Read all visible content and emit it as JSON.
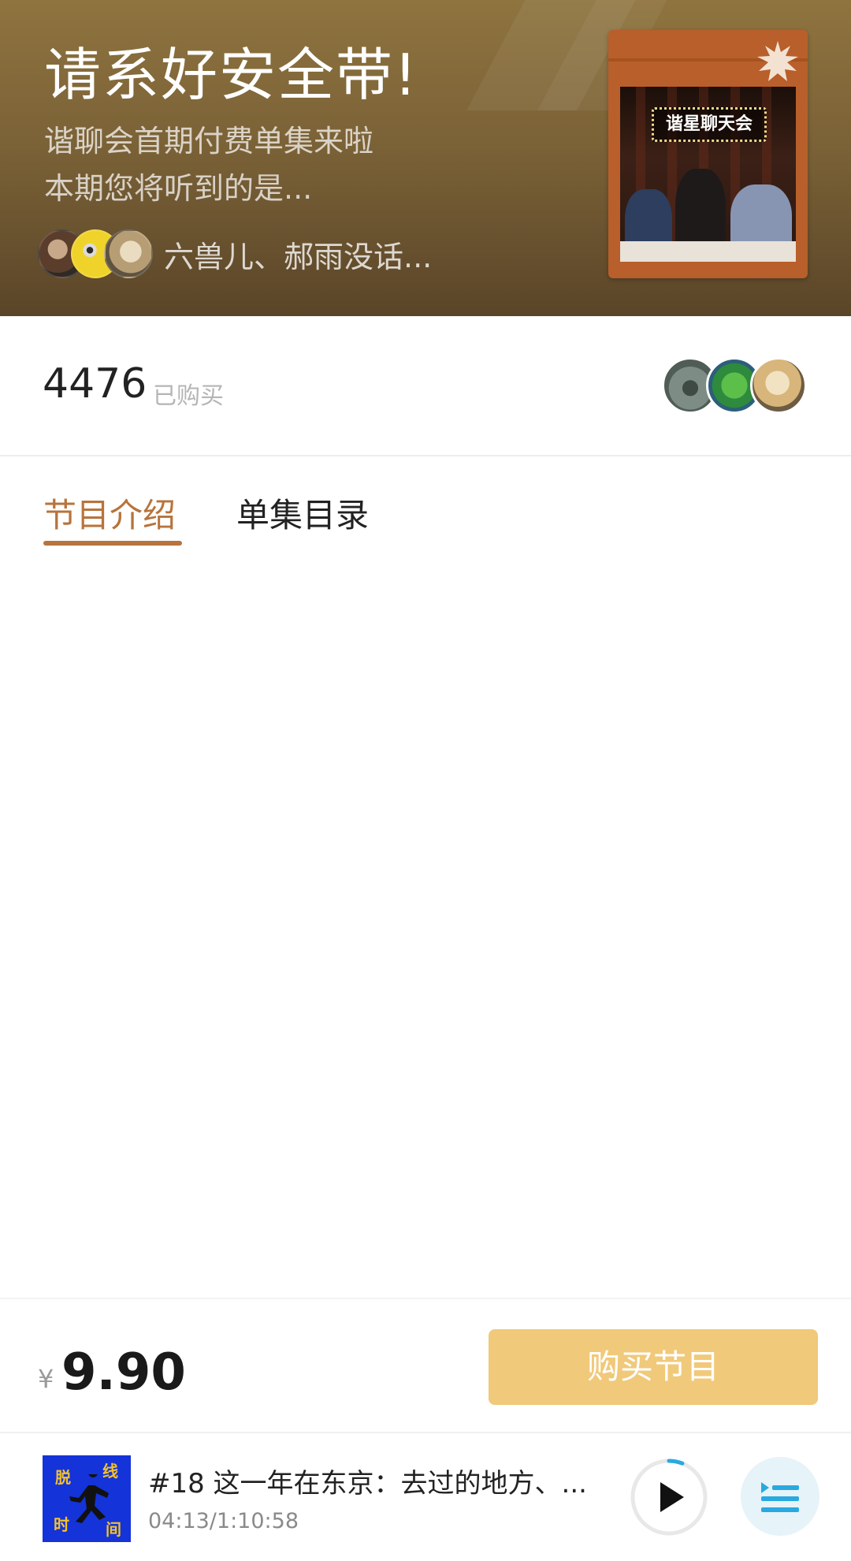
{
  "hero": {
    "title": "请系好安全带!",
    "subtitle_line1": "谐聊会首期付费单集来啦",
    "subtitle_line2": "本期您将听到的是...",
    "hosts_text": "六兽儿、郝雨没话...",
    "cover_label": "谐星聊天会"
  },
  "stats": {
    "purchase_count": "4476",
    "purchase_label": "已购买"
  },
  "tabs": [
    {
      "label": "节目介绍",
      "active": true
    },
    {
      "label": "单集目录",
      "active": false
    }
  ],
  "purchase": {
    "currency": "¥",
    "price": "9.90",
    "button_label": "购买节目"
  },
  "player": {
    "episode_title": "#18 这一年在东京：去过的地方、...",
    "time": "04:13/1:10:58",
    "art_text": [
      "脱",
      "线",
      "时",
      "间"
    ],
    "progress": 0.06
  },
  "colors": {
    "accent": "#b7743c",
    "buy_button": "#f0c97a",
    "player_accent": "#29a9df"
  },
  "icons": {
    "play": "play-icon",
    "playlist": "playlist-icon",
    "cover_badge": "starburst-icon"
  }
}
